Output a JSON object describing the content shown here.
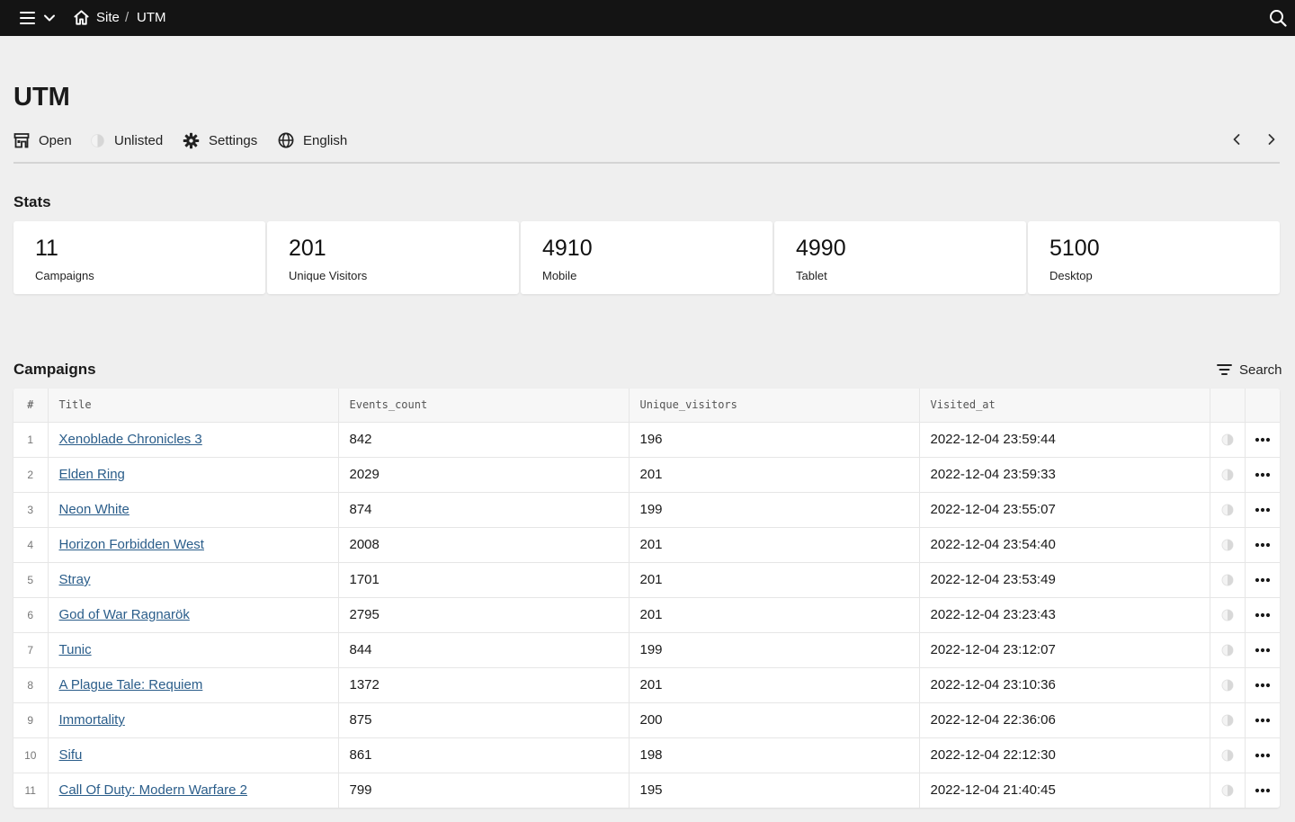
{
  "topbar": {
    "breadcrumb": [
      {
        "label": "Site"
      },
      {
        "label": "UTM"
      }
    ],
    "separator": "/"
  },
  "page": {
    "title": "UTM"
  },
  "toolbar": {
    "open_label": "Open",
    "unlisted_label": "Unlisted",
    "settings_label": "Settings",
    "language_label": "English"
  },
  "stats": {
    "title": "Stats",
    "cards": [
      {
        "value": "11",
        "label": "Campaigns"
      },
      {
        "value": "201",
        "label": "Unique Visitors"
      },
      {
        "value": "4910",
        "label": "Mobile"
      },
      {
        "value": "4990",
        "label": "Tablet"
      },
      {
        "value": "5100",
        "label": "Desktop"
      }
    ]
  },
  "campaigns": {
    "title": "Campaigns",
    "search_label": "Search",
    "columns": [
      "#",
      "Title",
      "Events_count",
      "Unique_visitors",
      "Visited_at"
    ],
    "rows": [
      {
        "index": "1",
        "title": "Xenoblade Chronicles 3",
        "events_count": "842",
        "unique_visitors": "196",
        "visited_at": "2022-12-04 23:59:44"
      },
      {
        "index": "2",
        "title": "Elden Ring",
        "events_count": "2029",
        "unique_visitors": "201",
        "visited_at": "2022-12-04 23:59:33"
      },
      {
        "index": "3",
        "title": "Neon White",
        "events_count": "874",
        "unique_visitors": "199",
        "visited_at": "2022-12-04 23:55:07"
      },
      {
        "index": "4",
        "title": "Horizon Forbidden West",
        "events_count": "2008",
        "unique_visitors": "201",
        "visited_at": "2022-12-04 23:54:40"
      },
      {
        "index": "5",
        "title": "Stray",
        "events_count": "1701",
        "unique_visitors": "201",
        "visited_at": "2022-12-04 23:53:49"
      },
      {
        "index": "6",
        "title": "God of War Ragnarök",
        "events_count": "2795",
        "unique_visitors": "201",
        "visited_at": "2022-12-04 23:23:43"
      },
      {
        "index": "7",
        "title": "Tunic",
        "events_count": "844",
        "unique_visitors": "199",
        "visited_at": "2022-12-04 23:12:07"
      },
      {
        "index": "8",
        "title": "A Plague Tale: Requiem",
        "events_count": "1372",
        "unique_visitors": "201",
        "visited_at": "2022-12-04 23:10:36"
      },
      {
        "index": "9",
        "title": "Immortality",
        "events_count": "875",
        "unique_visitors": "200",
        "visited_at": "2022-12-04 22:36:06"
      },
      {
        "index": "10",
        "title": "Sifu",
        "events_count": "861",
        "unique_visitors": "198",
        "visited_at": "2022-12-04 22:12:30"
      },
      {
        "index": "11",
        "title": "Call Of Duty: Modern Warfare 2",
        "events_count": "799",
        "unique_visitors": "195",
        "visited_at": "2022-12-04 21:40:45"
      }
    ]
  },
  "icons": {
    "menu": "menu-icon",
    "dropdown": "chevron-down-icon",
    "home": "home-icon",
    "search": "search-icon",
    "open": "storefront-icon",
    "unlisted": "half-circle-icon",
    "settings": "gear-icon",
    "language": "globe-icon",
    "prev": "chevron-left-icon",
    "next": "chevron-right-icon",
    "filter": "filter-icon",
    "row_status": "half-circle-icon",
    "row_actions": "more-horizontal-icon"
  },
  "colors": {
    "topbar_bg": "#141414",
    "page_bg": "#efefef",
    "link": "#2a5d8a"
  }
}
